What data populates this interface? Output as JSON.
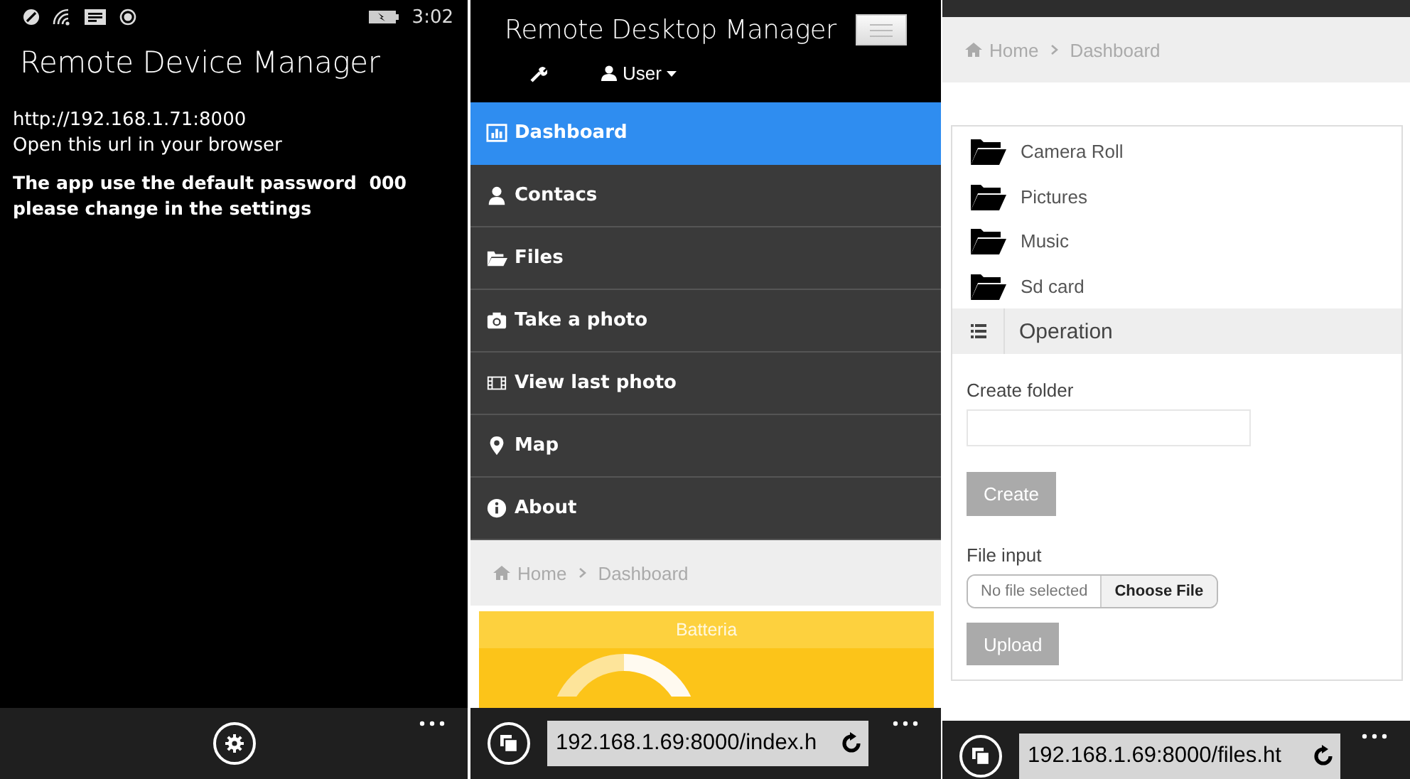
{
  "phone_app": {
    "status_bar": {
      "time": "3:02"
    },
    "title": "Remote Device Manager",
    "url": "http://192.168.1.71:8000",
    "instruction": "Open this url in your browser",
    "notice": "The app use the default password  000  please change in the settings"
  },
  "web_dashboard": {
    "title": "Remote Desktop Manager",
    "user_menu": "User",
    "menu": [
      {
        "label": "Dashboard",
        "selected": true
      },
      {
        "label": "Contacs",
        "selected": false
      },
      {
        "label": "Files",
        "selected": false
      },
      {
        "label": "Take a photo",
        "selected": false
      },
      {
        "label": "View last photo",
        "selected": false
      },
      {
        "label": "Map",
        "selected": false
      },
      {
        "label": "About",
        "selected": false
      }
    ],
    "breadcrumb": [
      "Home",
      "Dashboard"
    ],
    "card": {
      "title": "Batteria"
    },
    "address_bar": "192.168.1.69:8000/index.h"
  },
  "web_files": {
    "breadcrumb": [
      "Home",
      "Dashboard"
    ],
    "folders": [
      "Camera Roll",
      "Pictures",
      "Music",
      "Sd card"
    ],
    "operation": {
      "title": "Operation",
      "create_label": "Create folder",
      "create_button": "Create",
      "file_label": "File input",
      "file_status": "No file selected",
      "choose_button": "Choose File",
      "upload_button": "Upload"
    },
    "address_bar": "192.168.1.69:8000/files.ht"
  }
}
